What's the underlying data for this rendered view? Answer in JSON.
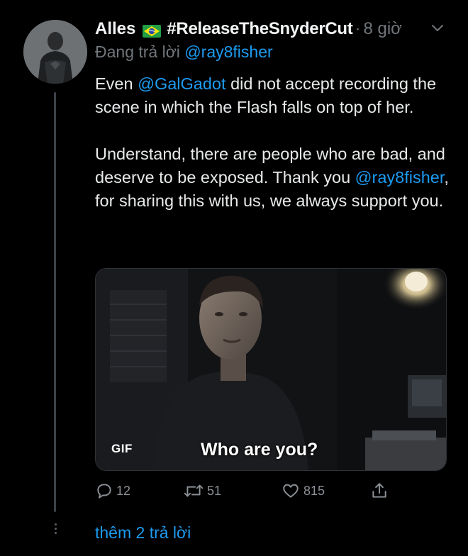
{
  "tweet": {
    "author_name": "Alles",
    "hashtag_name": "#ReleaseTheSnyderCut",
    "separator": "·",
    "time": "8 giờ",
    "reply_prefix": "Đang trả lời",
    "reply_to": "@ray8fisher",
    "body": {
      "p1_a": "Even ",
      "p1_mention": "@GalGadot",
      "p1_b": " did not accept recording the scene in which the Flash falls on top of her.",
      "p2_a": "Understand, there are people who are bad, and deserve to be exposed. Thank you ",
      "p2_mention": "@ray8fisher",
      "p2_b": ", for sharing this with us, we always support you."
    },
    "media": {
      "badge": "GIF",
      "caption": "Who are you?"
    },
    "actions": {
      "reply_count": "12",
      "retweet_count": "51",
      "like_count": "815"
    },
    "more_replies": "thêm 2 trả lời"
  },
  "icons": {
    "flag": "brazil-flag-icon",
    "menu": "chevron-down-icon",
    "reply": "reply-icon",
    "retweet": "retweet-icon",
    "like": "heart-icon",
    "share": "share-icon"
  },
  "colors": {
    "background": "#000000",
    "text": "#e7e9ea",
    "muted": "#71767b",
    "accent": "#1d9bf0",
    "thread_line": "#3d4247"
  }
}
